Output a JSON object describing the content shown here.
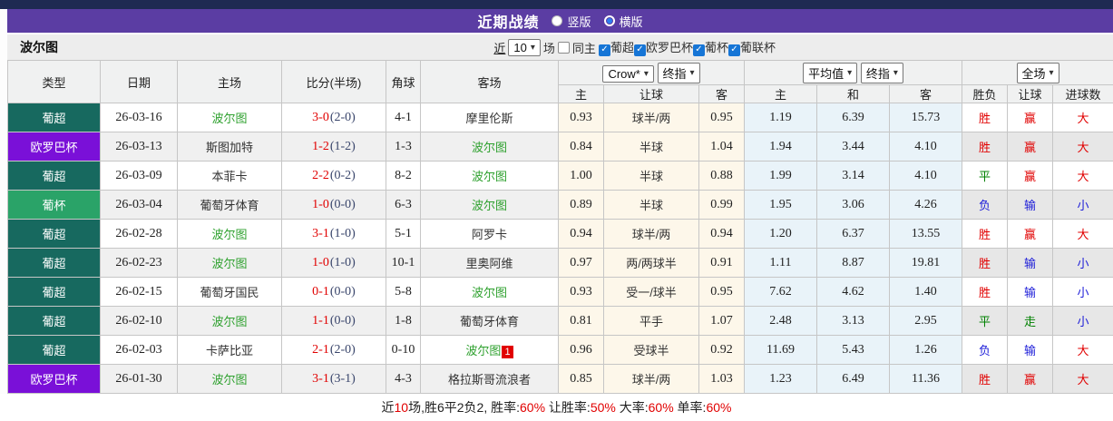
{
  "title_bar": {
    "title": "近期战绩",
    "radio_vertical": "竖版",
    "radio_horizontal": "横版",
    "selected": "横版"
  },
  "filter_bar": {
    "team": "波尔图",
    "recent_label": "近",
    "recent_value": "10",
    "matches_label": "场",
    "same_home_label": "同主",
    "same_home_checked": false,
    "leagues": [
      "葡超",
      "欧罗巴杯",
      "葡杯",
      "葡联杯"
    ],
    "leagues_checked": [
      true,
      true,
      true,
      true
    ]
  },
  "table": {
    "headers_left": [
      "类型",
      "日期",
      "主场",
      "比分(半场)",
      "角球",
      "客场"
    ],
    "dropdowns": {
      "ah_company": "Crow*",
      "ah_time": "终指",
      "eu_type": "平均值",
      "eu_time": "终指",
      "scope": "全场"
    },
    "headers_ah": [
      "主",
      "让球",
      "客"
    ],
    "headers_eu": [
      "主",
      "和",
      "客"
    ],
    "headers_result": [
      "胜负",
      "让球",
      "进球数"
    ],
    "rows": [
      {
        "league": "葡超",
        "league_class": "teal",
        "date": "26-03-16",
        "home": "波尔图",
        "home_team": true,
        "ft": "3-0",
        "ht": "(2-0)",
        "corner": "4-1",
        "away": "摩里伦斯",
        "away_team": false,
        "away_badge": "",
        "ah_home": "0.93",
        "ah_line": "球半/两",
        "ah_away": "0.95",
        "eu_home": "1.19",
        "eu_draw": "6.39",
        "eu_away": "15.73",
        "wdl": "胜",
        "wdl_c": "red",
        "hc": "赢",
        "hc_c": "red",
        "ou": "大",
        "ou_c": "red"
      },
      {
        "league": "欧罗巴杯",
        "league_class": "purple",
        "date": "26-03-13",
        "home": "斯图加特",
        "home_team": false,
        "ft": "1-2",
        "ht": "(1-2)",
        "corner": "1-3",
        "away": "波尔图",
        "away_team": true,
        "away_badge": "",
        "ah_home": "0.84",
        "ah_line": "半球",
        "ah_away": "1.04",
        "eu_home": "1.94",
        "eu_draw": "3.44",
        "eu_away": "4.10",
        "wdl": "胜",
        "wdl_c": "red",
        "hc": "赢",
        "hc_c": "red",
        "ou": "大",
        "ou_c": "red"
      },
      {
        "league": "葡超",
        "league_class": "teal",
        "date": "26-03-09",
        "home": "本菲卡",
        "home_team": false,
        "ft": "2-2",
        "ht": "(0-2)",
        "corner": "8-2",
        "away": "波尔图",
        "away_team": true,
        "away_badge": "",
        "ah_home": "1.00",
        "ah_line": "半球",
        "ah_away": "0.88",
        "eu_home": "1.99",
        "eu_draw": "3.14",
        "eu_away": "4.10",
        "wdl": "平",
        "wdl_c": "green",
        "hc": "赢",
        "hc_c": "red",
        "ou": "大",
        "ou_c": "red"
      },
      {
        "league": "葡杯",
        "league_class": "green",
        "date": "26-03-04",
        "home": "葡萄牙体育",
        "home_team": false,
        "ft": "1-0",
        "ht": "(0-0)",
        "corner": "6-3",
        "away": "波尔图",
        "away_team": true,
        "away_badge": "",
        "ah_home": "0.89",
        "ah_line": "半球",
        "ah_away": "0.99",
        "eu_home": "1.95",
        "eu_draw": "3.06",
        "eu_away": "4.26",
        "wdl": "负",
        "wdl_c": "blue",
        "hc": "输",
        "hc_c": "blue",
        "ou": "小",
        "ou_c": "blue"
      },
      {
        "league": "葡超",
        "league_class": "teal",
        "date": "26-02-28",
        "home": "波尔图",
        "home_team": true,
        "ft": "3-1",
        "ht": "(1-0)",
        "corner": "5-1",
        "away": "阿罗卡",
        "away_team": false,
        "away_badge": "",
        "ah_home": "0.94",
        "ah_line": "球半/两",
        "ah_away": "0.94",
        "eu_home": "1.20",
        "eu_draw": "6.37",
        "eu_away": "13.55",
        "wdl": "胜",
        "wdl_c": "red",
        "hc": "赢",
        "hc_c": "red",
        "ou": "大",
        "ou_c": "red"
      },
      {
        "league": "葡超",
        "league_class": "teal",
        "date": "26-02-23",
        "home": "波尔图",
        "home_team": true,
        "ft": "1-0",
        "ht": "(1-0)",
        "corner": "10-1",
        "away": "里奥阿维",
        "away_team": false,
        "away_badge": "",
        "ah_home": "0.97",
        "ah_line": "两/两球半",
        "ah_away": "0.91",
        "eu_home": "1.11",
        "eu_draw": "8.87",
        "eu_away": "19.81",
        "wdl": "胜",
        "wdl_c": "red",
        "hc": "输",
        "hc_c": "blue",
        "ou": "小",
        "ou_c": "blue"
      },
      {
        "league": "葡超",
        "league_class": "teal",
        "date": "26-02-15",
        "home": "葡萄牙国民",
        "home_team": false,
        "ft": "0-1",
        "ht": "(0-0)",
        "corner": "5-8",
        "away": "波尔图",
        "away_team": true,
        "away_badge": "",
        "ah_home": "0.93",
        "ah_line": "受一/球半",
        "ah_away": "0.95",
        "eu_home": "7.62",
        "eu_draw": "4.62",
        "eu_away": "1.40",
        "wdl": "胜",
        "wdl_c": "red",
        "hc": "输",
        "hc_c": "blue",
        "ou": "小",
        "ou_c": "blue"
      },
      {
        "league": "葡超",
        "league_class": "teal",
        "date": "26-02-10",
        "home": "波尔图",
        "home_team": true,
        "ft": "1-1",
        "ht": "(0-0)",
        "corner": "1-8",
        "away": "葡萄牙体育",
        "away_team": false,
        "away_badge": "",
        "ah_home": "0.81",
        "ah_line": "平手",
        "ah_away": "1.07",
        "eu_home": "2.48",
        "eu_draw": "3.13",
        "eu_away": "2.95",
        "wdl": "平",
        "wdl_c": "green",
        "hc": "走",
        "hc_c": "green",
        "ou": "小",
        "ou_c": "blue"
      },
      {
        "league": "葡超",
        "league_class": "teal",
        "date": "26-02-03",
        "home": "卡萨比亚",
        "home_team": false,
        "ft": "2-1",
        "ht": "(2-0)",
        "corner": "0-10",
        "away": "波尔图",
        "away_team": true,
        "away_badge": "1",
        "ah_home": "0.96",
        "ah_line": "受球半",
        "ah_away": "0.92",
        "eu_home": "11.69",
        "eu_draw": "5.43",
        "eu_away": "1.26",
        "wdl": "负",
        "wdl_c": "blue",
        "hc": "输",
        "hc_c": "blue",
        "ou": "大",
        "ou_c": "red"
      },
      {
        "league": "欧罗巴杯",
        "league_class": "purple",
        "date": "26-01-30",
        "home": "波尔图",
        "home_team": true,
        "ft": "3-1",
        "ht": "(3-1)",
        "corner": "4-3",
        "away": "格拉斯哥流浪者",
        "away_team": false,
        "away_badge": "",
        "ah_home": "0.85",
        "ah_line": "球半/两",
        "ah_away": "1.03",
        "eu_home": "1.23",
        "eu_draw": "6.49",
        "eu_away": "11.36",
        "wdl": "胜",
        "wdl_c": "red",
        "hc": "赢",
        "hc_c": "red",
        "ou": "大",
        "ou_c": "red"
      }
    ]
  },
  "footer": {
    "segments": [
      {
        "t": "近",
        "c": "dark"
      },
      {
        "t": "10",
        "c": "red"
      },
      {
        "t": "场,胜6平2负2, 胜率:",
        "c": "dark"
      },
      {
        "t": "60%",
        "c": "red"
      },
      {
        "t": " 让胜率:",
        "c": "dark"
      },
      {
        "t": "50%",
        "c": "red"
      },
      {
        "t": " 大率:",
        "c": "dark"
      },
      {
        "t": "60%",
        "c": "red"
      },
      {
        "t": " 单率:",
        "c": "dark"
      },
      {
        "t": "60%",
        "c": "red"
      }
    ]
  },
  "colors": {
    "topbar_navy": "#1e2a52",
    "titlebar_purple": "#5b3da3",
    "badge_teal": "#17695f",
    "badge_purple": "#7a10d8",
    "badge_green": "#2aa368",
    "team_green": "#2fa12f",
    "win_red": "#e10000",
    "draw_green": "#008000",
    "lose_blue": "#1c1cd8",
    "ah_col_bg": "#fdf7ea",
    "eu_col_bg": "#e9f3f9"
  }
}
